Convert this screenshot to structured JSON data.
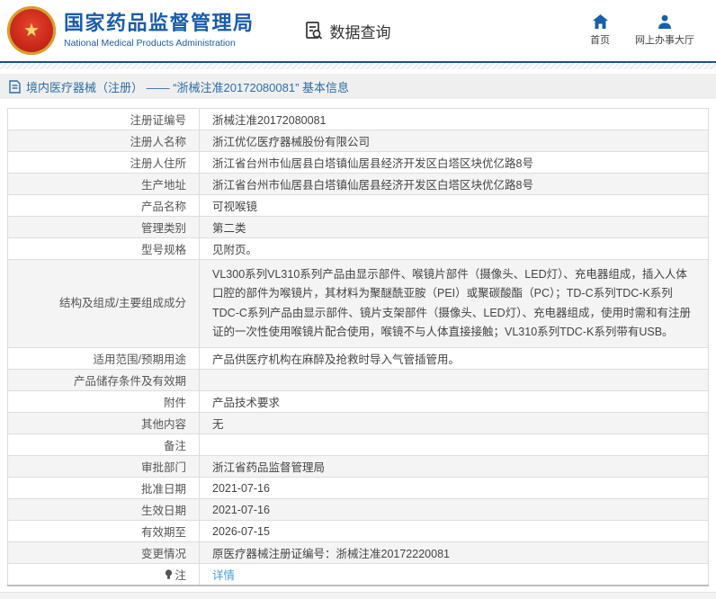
{
  "header": {
    "title": "国家药品监督管理局",
    "subtitle": "National Medical Products Administration",
    "data_query": "数据查询",
    "nav": [
      {
        "label": "首页",
        "icon": "home-icon"
      },
      {
        "label": "网上办事大厅",
        "icon": "person-icon"
      }
    ]
  },
  "breadcrumb": {
    "text": "境内医疗器械（注册） —— “浙械注准20172080081” 基本信息"
  },
  "table": {
    "rows": [
      {
        "label": "注册证编号",
        "value": "浙械注准20172080081"
      },
      {
        "label": "注册人名称",
        "value": "浙江优亿医疗器械股份有限公司"
      },
      {
        "label": "注册人住所",
        "value": "浙江省台州市仙居县白塔镇仙居县经济开发区白塔区块优亿路8号"
      },
      {
        "label": "生产地址",
        "value": "浙江省台州市仙居县白塔镇仙居县经济开发区白塔区块优亿路8号"
      },
      {
        "label": "产品名称",
        "value": "可视喉镜"
      },
      {
        "label": "管理类别",
        "value": "第二类"
      },
      {
        "label": "型号规格",
        "value": "见附页。"
      },
      {
        "label": "结构及组成/主要组成成分",
        "value": "VL300系列VL310系列产品由显示部件、喉镜片部件（摄像头、LED灯）、充电器组成，插入人体口腔的部件为喉镜片，其材料为聚醚酰亚胺（PEI）或聚碳酸酯（PC）；TD-C系列TDC-K系列TDC-C系列产品由显示部件、镜片支架部件（摄像头、LED灯）、充电器组成，使用时需和有注册证的一次性使用喉镜片配合使用，喉镜不与人体直接接触；VL310系列TDC-K系列带有USB。",
        "tall": true
      },
      {
        "label": "适用范围/预期用途",
        "value": "产品供医疗机构在麻醉及抢救时导入气管插管用。"
      },
      {
        "label": "产品储存条件及有效期",
        "value": ""
      },
      {
        "label": "附件",
        "value": "产品技术要求"
      },
      {
        "label": "其他内容",
        "value": "无"
      },
      {
        "label": "备注",
        "value": ""
      },
      {
        "label": "审批部门",
        "value": "浙江省药品监督管理局"
      },
      {
        "label": "批准日期",
        "value": "2021-07-16"
      },
      {
        "label": "生效日期",
        "value": "2021-07-16"
      },
      {
        "label": "有效期至",
        "value": "2026-07-15"
      },
      {
        "label": "变更情况",
        "value": "原医疗器械注册证编号：浙械注准20172220081"
      },
      {
        "label": "注",
        "value": "详情",
        "link": true,
        "icon": "lightbulb-icon"
      }
    ]
  },
  "colors": {
    "accent_blue": "#1a5cab",
    "header_line_blue": "#16548f",
    "breadcrumb_text": "#2d6da8",
    "link_blue": "#4aa0d8",
    "row_alt_gray": "#f4f4f4"
  }
}
